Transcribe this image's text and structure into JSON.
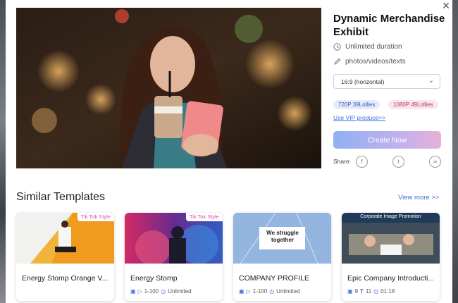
{
  "modal": {
    "close_label": "×",
    "title": "Dynamic Merchandise Exhibit",
    "duration": "Unlimited duration",
    "media": "photos/videos/texts",
    "aspect_select": "16:9 (horizontal)",
    "prices": [
      "720P 39Lollies",
      "1080P 49Lollies"
    ],
    "vip_link": "Use VIP produce>>",
    "create_button": "Create Now",
    "share_label": "Share:",
    "share_icons": [
      "facebook-icon",
      "twitter-icon",
      "link-icon"
    ]
  },
  "similar": {
    "heading": "Similar Templates",
    "view_more": "View more >>",
    "cards": [
      {
        "name": "Energy Stomp Orange V...",
        "tag": "Tik Tok Style"
      },
      {
        "name": "Energy Stomp",
        "tag": "Tik Tok Style",
        "count": "1-100",
        "duration": "Unlimited"
      },
      {
        "name": "COMPANY PROFILE",
        "overlay": "We struggle together",
        "count": "1-100",
        "duration": "Unlimited"
      },
      {
        "name": "Epic Company Introducti...",
        "banner": "Corporate Image Promotion",
        "images": "9",
        "texts": "11",
        "duration": "01:18"
      }
    ]
  },
  "colors": {
    "accent_link": "#3b6ee0",
    "create_gradient_start": "#8fb1f3",
    "create_gradient_end": "#e6b2d6"
  }
}
